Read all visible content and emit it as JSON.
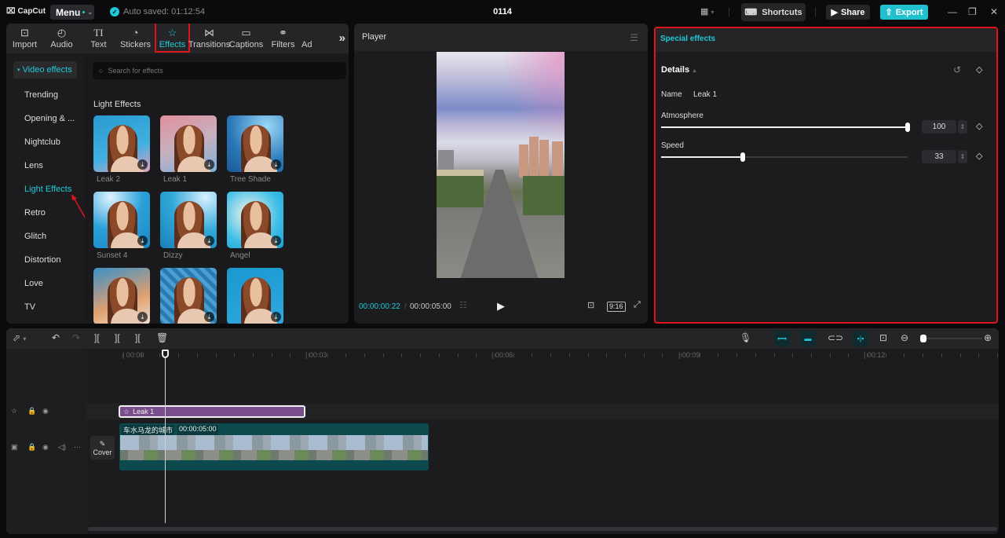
{
  "app": {
    "logo": "CapCut",
    "menu_label": "Menu",
    "autosave": "Auto saved: 01:12:54",
    "project_title": "0114",
    "shortcuts_label": "Shortcuts",
    "share_label": "Share",
    "export_label": "Export",
    "accent": "#20c9d8"
  },
  "media_toolbar": [
    {
      "label": "Import",
      "icon": "import-icon"
    },
    {
      "label": "Audio",
      "icon": "audio-icon"
    },
    {
      "label": "Text",
      "icon": "text-icon"
    },
    {
      "label": "Stickers",
      "icon": "sticker-icon"
    },
    {
      "label": "Effects",
      "icon": "effects-icon",
      "active": true
    },
    {
      "label": "Transitions",
      "icon": "transition-icon"
    },
    {
      "label": "Captions",
      "icon": "captions-icon"
    },
    {
      "label": "Filters",
      "icon": "filters-icon"
    },
    {
      "label": "Ad",
      "icon": "adjust-icon"
    }
  ],
  "categories": {
    "header": "Video effects",
    "items": [
      "Trending",
      "Opening & ...",
      "Nightclub",
      "Lens",
      "Light Effects",
      "Retro",
      "Glitch",
      "Distortion",
      "Love",
      "TV"
    ],
    "active": "Light Effects"
  },
  "effects": {
    "search_placeholder": "Search for effects",
    "section_title": "Light Effects",
    "cards": [
      {
        "name": "Leak 2"
      },
      {
        "name": "Leak 1"
      },
      {
        "name": "Tree Shade"
      },
      {
        "name": "Sunset 4"
      },
      {
        "name": "Dizzy"
      },
      {
        "name": "Angel"
      },
      {
        "name": ""
      },
      {
        "name": ""
      },
      {
        "name": ""
      }
    ]
  },
  "player": {
    "title": "Player",
    "current_time": "00:00:00:22",
    "total_time": "00:00:05:00",
    "ratio": "9:16"
  },
  "properties": {
    "tab_title": "Special effects",
    "section": "Details",
    "name_label": "Name",
    "name_value": "Leak 1",
    "params": [
      {
        "label": "Atmosphere",
        "value": "100",
        "fraction": 1.0
      },
      {
        "label": "Speed",
        "value": "33",
        "fraction": 0.33
      }
    ]
  },
  "timeline": {
    "ruler_labels": [
      "00:00",
      "00:03",
      "00:06",
      "00:09",
      "00:12"
    ],
    "effect_clip": {
      "label": "Leak 1"
    },
    "video_clip": {
      "name": "车水马龙的城市",
      "duration": "00:00:05:00"
    },
    "cover_label": "Cover",
    "zoom_fraction": 0.05
  }
}
